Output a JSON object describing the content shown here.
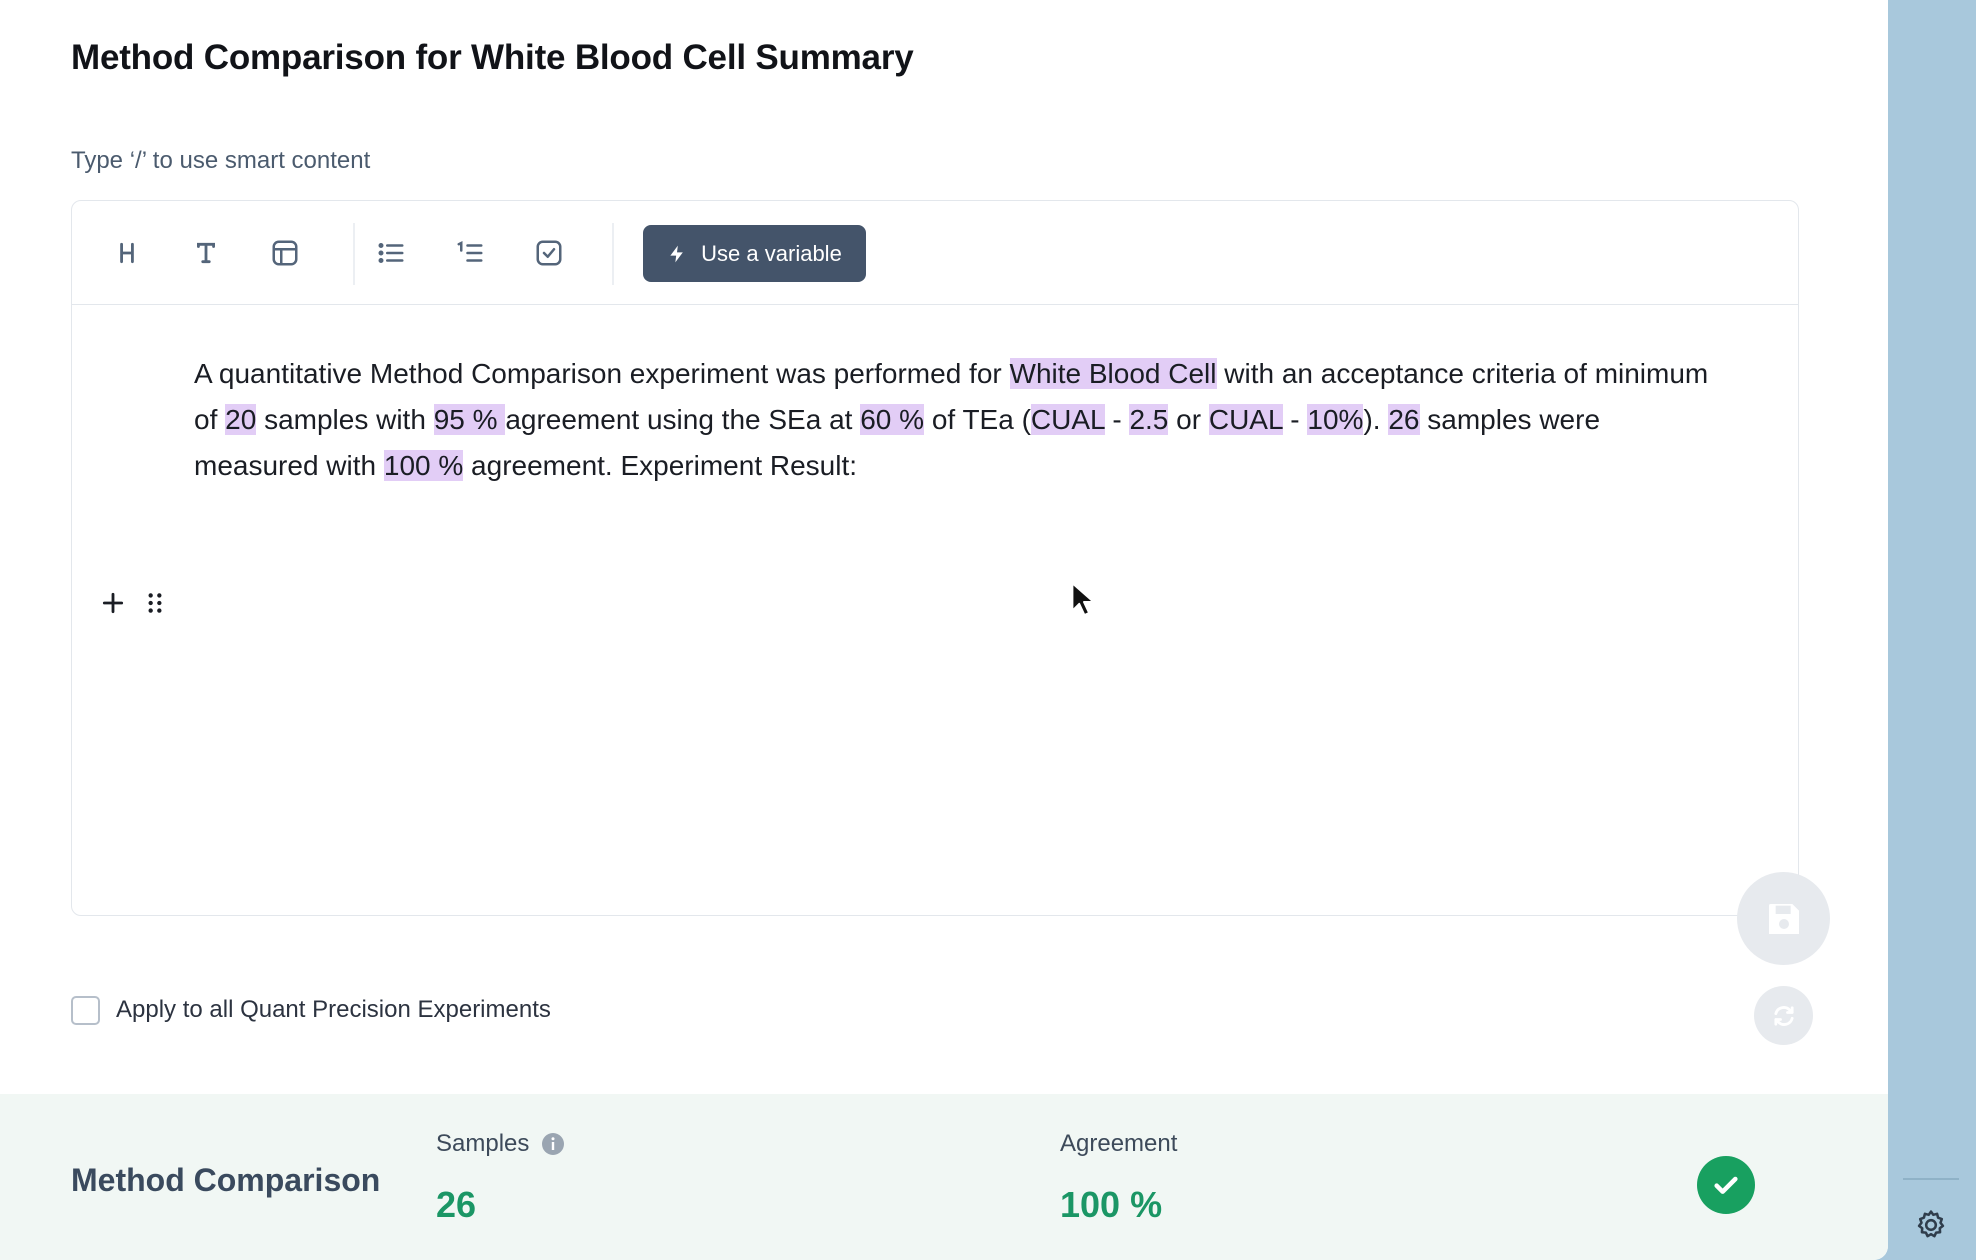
{
  "editor_title": "Method Comparison for White Blood Cell Summary",
  "hint": "Type ‘/’ to use smart content",
  "toolbar": {
    "items": [
      {
        "name": "heading-icon"
      },
      {
        "name": "text-icon"
      },
      {
        "name": "table-icon"
      },
      {
        "name": "bullet-list-icon"
      },
      {
        "name": "numbered-list-icon"
      },
      {
        "name": "checklist-icon"
      }
    ],
    "variable_button": "Use a variable"
  },
  "content": {
    "segments": [
      {
        "text": "A quantitative Method Comparison experiment was performed for ",
        "var": false
      },
      {
        "text": "White Blood Cell",
        "var": true
      },
      {
        "text": " with an acceptance criteria of minimum of ",
        "var": false
      },
      {
        "text": "20",
        "var": true
      },
      {
        "text": " samples with ",
        "var": false
      },
      {
        "text": "95 % ",
        "var": true
      },
      {
        "text": " agreement using the SEa at ",
        "var": false
      },
      {
        "text": "60 %",
        "var": true
      },
      {
        "text": " of TEa (",
        "var": false
      },
      {
        "text": "CUAL",
        "var": true
      },
      {
        "text": " - ",
        "var": false
      },
      {
        "text": "2.5",
        "var": true
      },
      {
        "text": " or ",
        "var": false
      },
      {
        "text": "CUAL",
        "var": true
      },
      {
        "text": " - ",
        "var": false
      },
      {
        "text": "10%",
        "var": true
      },
      {
        "text": "). ",
        "var": false
      },
      {
        "text": "26",
        "var": true
      },
      {
        "text": " samples were measured with ",
        "var": false
      },
      {
        "text": "100 %",
        "var": true
      },
      {
        "text": " agreement. Experiment Result:",
        "var": false
      }
    ]
  },
  "apply_all_label": "Apply to all Quant Precision Experiments",
  "apply_all_checked": false,
  "summary": {
    "title": "Method Comparison",
    "samples_label": "Samples",
    "samples_value": "26",
    "agreement_label": "Agreement",
    "agreement_value": "100 %",
    "status": "pass"
  },
  "colors": {
    "variable_highlight": "#e2cdf6",
    "primary_button": "#44546a",
    "success": "#18a060",
    "metric_value": "#1b9665",
    "side_rail": "#a8c8dc"
  }
}
